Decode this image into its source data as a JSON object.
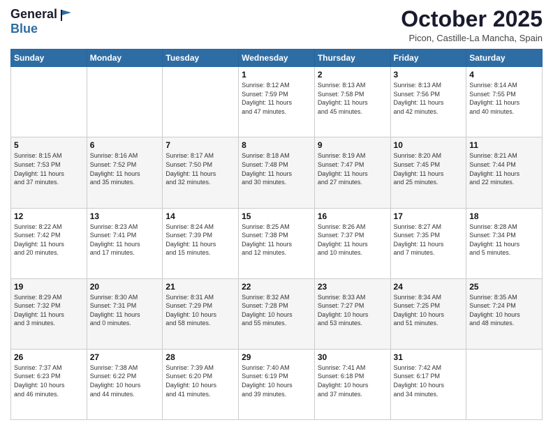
{
  "header": {
    "logo_line1": "General",
    "logo_line2": "Blue",
    "month": "October 2025",
    "location": "Picon, Castille-La Mancha, Spain"
  },
  "weekdays": [
    "Sunday",
    "Monday",
    "Tuesday",
    "Wednesday",
    "Thursday",
    "Friday",
    "Saturday"
  ],
  "weeks": [
    [
      {
        "day": "",
        "info": ""
      },
      {
        "day": "",
        "info": ""
      },
      {
        "day": "",
        "info": ""
      },
      {
        "day": "1",
        "info": "Sunrise: 8:12 AM\nSunset: 7:59 PM\nDaylight: 11 hours\nand 47 minutes."
      },
      {
        "day": "2",
        "info": "Sunrise: 8:13 AM\nSunset: 7:58 PM\nDaylight: 11 hours\nand 45 minutes."
      },
      {
        "day": "3",
        "info": "Sunrise: 8:13 AM\nSunset: 7:56 PM\nDaylight: 11 hours\nand 42 minutes."
      },
      {
        "day": "4",
        "info": "Sunrise: 8:14 AM\nSunset: 7:55 PM\nDaylight: 11 hours\nand 40 minutes."
      }
    ],
    [
      {
        "day": "5",
        "info": "Sunrise: 8:15 AM\nSunset: 7:53 PM\nDaylight: 11 hours\nand 37 minutes."
      },
      {
        "day": "6",
        "info": "Sunrise: 8:16 AM\nSunset: 7:52 PM\nDaylight: 11 hours\nand 35 minutes."
      },
      {
        "day": "7",
        "info": "Sunrise: 8:17 AM\nSunset: 7:50 PM\nDaylight: 11 hours\nand 32 minutes."
      },
      {
        "day": "8",
        "info": "Sunrise: 8:18 AM\nSunset: 7:48 PM\nDaylight: 11 hours\nand 30 minutes."
      },
      {
        "day": "9",
        "info": "Sunrise: 8:19 AM\nSunset: 7:47 PM\nDaylight: 11 hours\nand 27 minutes."
      },
      {
        "day": "10",
        "info": "Sunrise: 8:20 AM\nSunset: 7:45 PM\nDaylight: 11 hours\nand 25 minutes."
      },
      {
        "day": "11",
        "info": "Sunrise: 8:21 AM\nSunset: 7:44 PM\nDaylight: 11 hours\nand 22 minutes."
      }
    ],
    [
      {
        "day": "12",
        "info": "Sunrise: 8:22 AM\nSunset: 7:42 PM\nDaylight: 11 hours\nand 20 minutes."
      },
      {
        "day": "13",
        "info": "Sunrise: 8:23 AM\nSunset: 7:41 PM\nDaylight: 11 hours\nand 17 minutes."
      },
      {
        "day": "14",
        "info": "Sunrise: 8:24 AM\nSunset: 7:39 PM\nDaylight: 11 hours\nand 15 minutes."
      },
      {
        "day": "15",
        "info": "Sunrise: 8:25 AM\nSunset: 7:38 PM\nDaylight: 11 hours\nand 12 minutes."
      },
      {
        "day": "16",
        "info": "Sunrise: 8:26 AM\nSunset: 7:37 PM\nDaylight: 11 hours\nand 10 minutes."
      },
      {
        "day": "17",
        "info": "Sunrise: 8:27 AM\nSunset: 7:35 PM\nDaylight: 11 hours\nand 7 minutes."
      },
      {
        "day": "18",
        "info": "Sunrise: 8:28 AM\nSunset: 7:34 PM\nDaylight: 11 hours\nand 5 minutes."
      }
    ],
    [
      {
        "day": "19",
        "info": "Sunrise: 8:29 AM\nSunset: 7:32 PM\nDaylight: 11 hours\nand 3 minutes."
      },
      {
        "day": "20",
        "info": "Sunrise: 8:30 AM\nSunset: 7:31 PM\nDaylight: 11 hours\nand 0 minutes."
      },
      {
        "day": "21",
        "info": "Sunrise: 8:31 AM\nSunset: 7:29 PM\nDaylight: 10 hours\nand 58 minutes."
      },
      {
        "day": "22",
        "info": "Sunrise: 8:32 AM\nSunset: 7:28 PM\nDaylight: 10 hours\nand 55 minutes."
      },
      {
        "day": "23",
        "info": "Sunrise: 8:33 AM\nSunset: 7:27 PM\nDaylight: 10 hours\nand 53 minutes."
      },
      {
        "day": "24",
        "info": "Sunrise: 8:34 AM\nSunset: 7:25 PM\nDaylight: 10 hours\nand 51 minutes."
      },
      {
        "day": "25",
        "info": "Sunrise: 8:35 AM\nSunset: 7:24 PM\nDaylight: 10 hours\nand 48 minutes."
      }
    ],
    [
      {
        "day": "26",
        "info": "Sunrise: 7:37 AM\nSunset: 6:23 PM\nDaylight: 10 hours\nand 46 minutes."
      },
      {
        "day": "27",
        "info": "Sunrise: 7:38 AM\nSunset: 6:22 PM\nDaylight: 10 hours\nand 44 minutes."
      },
      {
        "day": "28",
        "info": "Sunrise: 7:39 AM\nSunset: 6:20 PM\nDaylight: 10 hours\nand 41 minutes."
      },
      {
        "day": "29",
        "info": "Sunrise: 7:40 AM\nSunset: 6:19 PM\nDaylight: 10 hours\nand 39 minutes."
      },
      {
        "day": "30",
        "info": "Sunrise: 7:41 AM\nSunset: 6:18 PM\nDaylight: 10 hours\nand 37 minutes."
      },
      {
        "day": "31",
        "info": "Sunrise: 7:42 AM\nSunset: 6:17 PM\nDaylight: 10 hours\nand 34 minutes."
      },
      {
        "day": "",
        "info": ""
      }
    ]
  ]
}
